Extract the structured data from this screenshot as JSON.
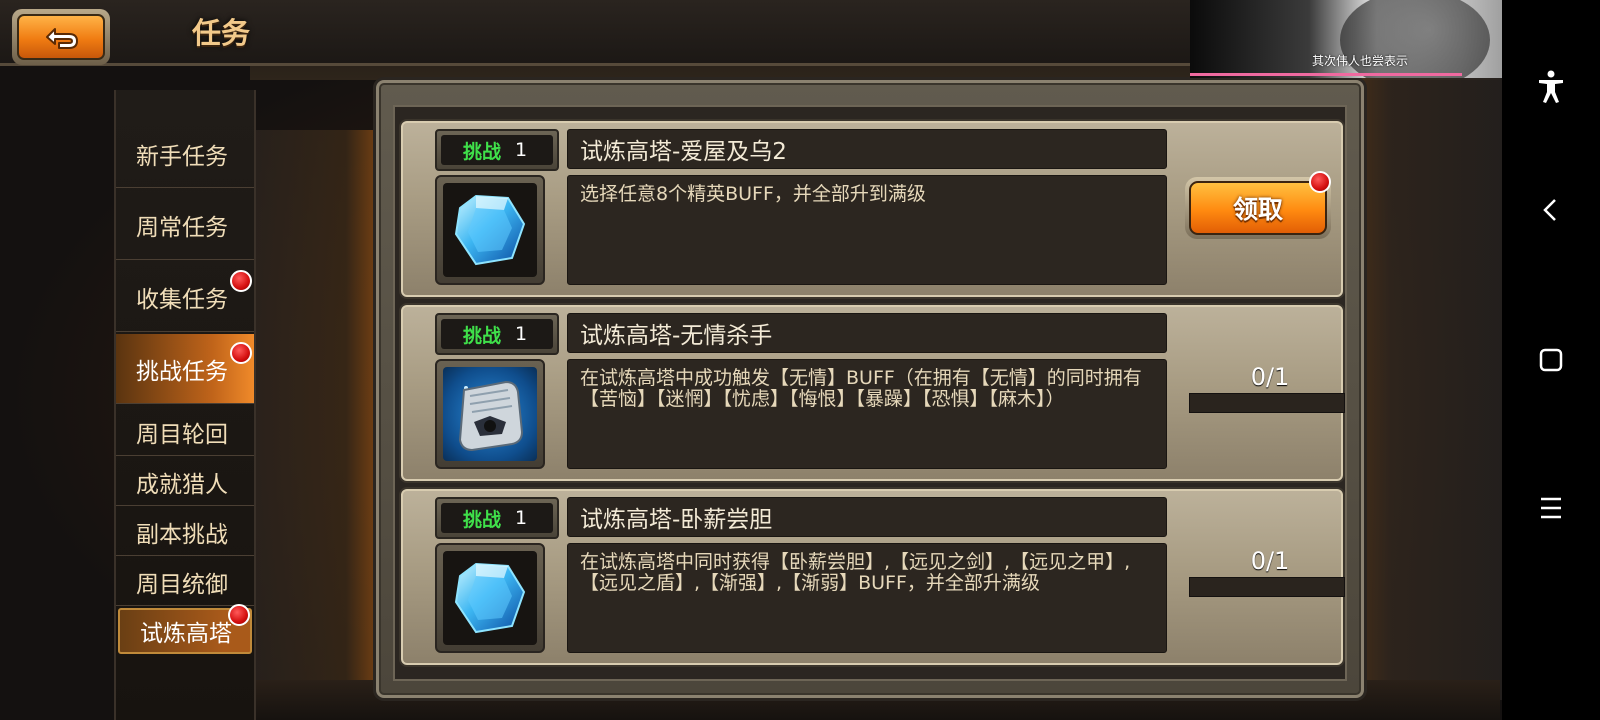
{
  "header": {
    "title": "任务"
  },
  "sidebar": {
    "items": [
      {
        "label": "新手任务",
        "badge": false
      },
      {
        "label": "周常任务",
        "badge": false
      },
      {
        "label": "收集任务",
        "badge": true
      },
      {
        "label": "挑战任务",
        "badge": true,
        "active": true
      },
      {
        "label": "周目轮回",
        "badge": false
      },
      {
        "label": "成就猎人",
        "badge": false
      },
      {
        "label": "副本挑战",
        "badge": false
      },
      {
        "label": "周目统御",
        "badge": false
      },
      {
        "label": "试炼高塔",
        "badge": true,
        "active": true
      }
    ]
  },
  "quests": [
    {
      "tag_label": "挑战",
      "tag_num": "1",
      "name": "试炼高塔-爱屋及乌2",
      "icon": "blue-crystal-icon",
      "description": "选择任意8个精英BUFF，并全部升到满级",
      "action": {
        "type": "claim",
        "label": "领取",
        "badge": true
      }
    },
    {
      "tag_label": "挑战",
      "tag_num": "1",
      "name": "试炼高塔-无情杀手",
      "icon": "scroll-icon",
      "description": "在试炼高塔中成功触发【无情】BUFF（在拥有【无情】的同时拥有【苦恼】【迷惘】【忧虑】【悔恨】【暴躁】【恐惧】【麻木】）",
      "action": {
        "type": "progress",
        "text": "0/1",
        "progress": 0
      }
    },
    {
      "tag_label": "挑战",
      "tag_num": "1",
      "name": "试炼高塔-卧薪尝胆",
      "icon": "blue-crystal-icon",
      "description": "在试炼高塔中同时获得【卧薪尝胆】,【远见之剑】,【远见之甲】,【远见之盾】,【渐强】,【渐弱】BUFF，并全部升满级",
      "action": {
        "type": "progress",
        "text": "0/1",
        "progress": 0
      }
    }
  ],
  "video_overlay": {
    "caption": "其次伟人也尝表示",
    "corner": "1"
  },
  "colors": {
    "accent_orange": "#f07c12",
    "tag_green": "#3fe04a",
    "badge_red": "#d40f0f",
    "title_gold": "#f2c98a"
  }
}
